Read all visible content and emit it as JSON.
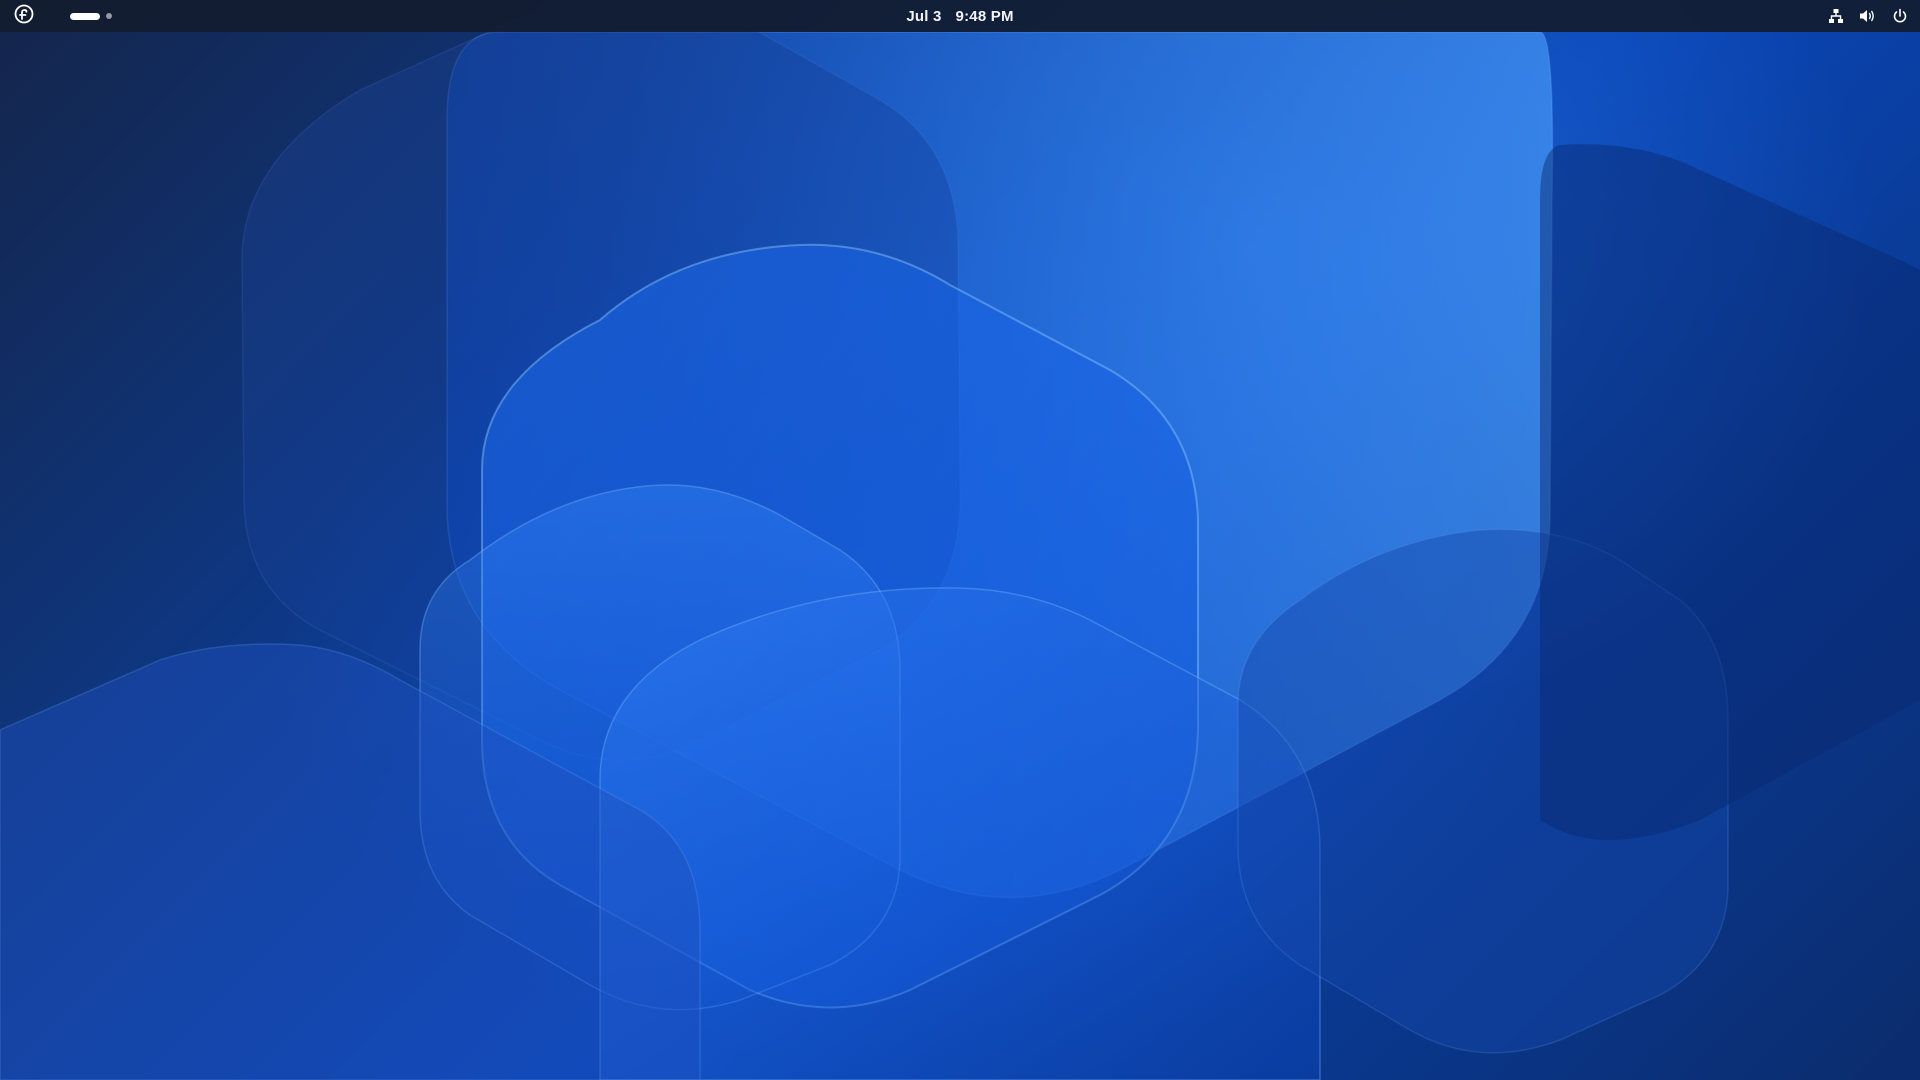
{
  "topbar": {
    "activities_icon": "fedora-logo-icon",
    "workspaces": {
      "count": 2,
      "active_index": 0
    },
    "clock": {
      "date": "Jul 3",
      "time": "9:48 PM"
    },
    "system_tray": {
      "icons": [
        "network-wired-icon",
        "volume-icon",
        "power-icon"
      ]
    }
  },
  "wallpaper": {
    "description_colors": {
      "dark_navy": "#14254a",
      "deep_blue": "#0a3a94",
      "bright_blue": "#0a6bea",
      "highlight": "#4aa0ff"
    }
  }
}
